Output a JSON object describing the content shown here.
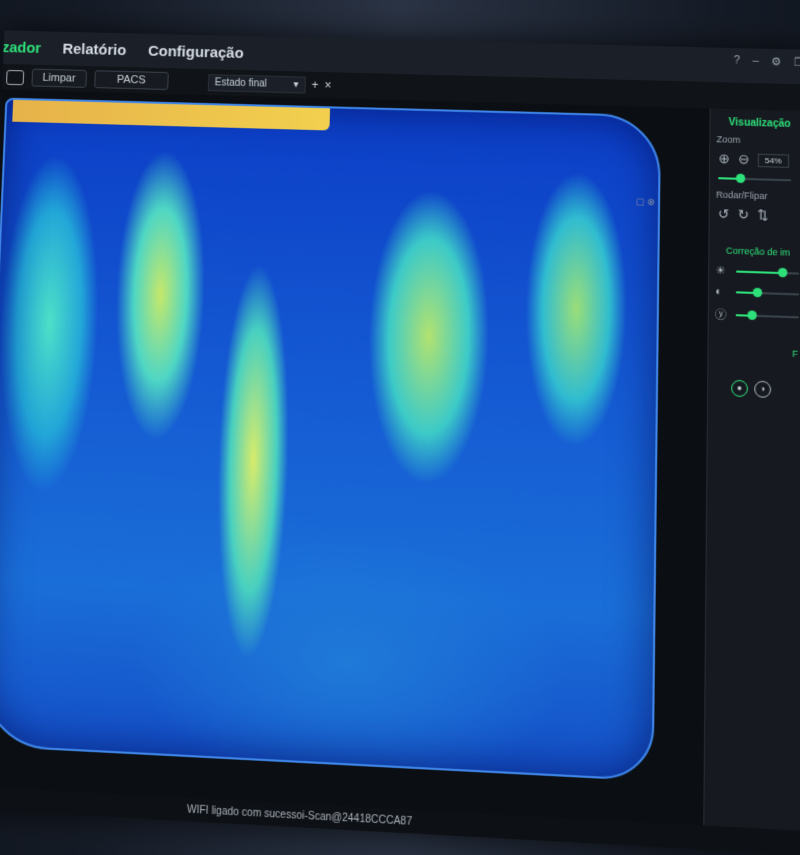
{
  "menu": {
    "items": [
      {
        "label": "izador",
        "active": true
      },
      {
        "label": "Relatório",
        "active": false
      },
      {
        "label": "Configuração",
        "active": false
      }
    ]
  },
  "window_controls": {
    "help": "?",
    "minimize": "–",
    "settings": "⚙",
    "restore": "❐"
  },
  "toolbar": {
    "clear_label": "Limpar",
    "pacs_label": "PACS",
    "state_value": "Estado final",
    "add_label": "+",
    "close_label": "×"
  },
  "panel": {
    "title": "Visualização",
    "zoom_label": "Zoom",
    "zoom_value": "54%",
    "rotate_label": "Rodar/Flipar",
    "correction_title": "Correção de im",
    "section_f": "F"
  },
  "status": {
    "text": "WIFI ligado com sucessoi-Scan@24418CCCA87"
  },
  "colors": {
    "accent": "#2ee07a",
    "background": "#15191f"
  }
}
